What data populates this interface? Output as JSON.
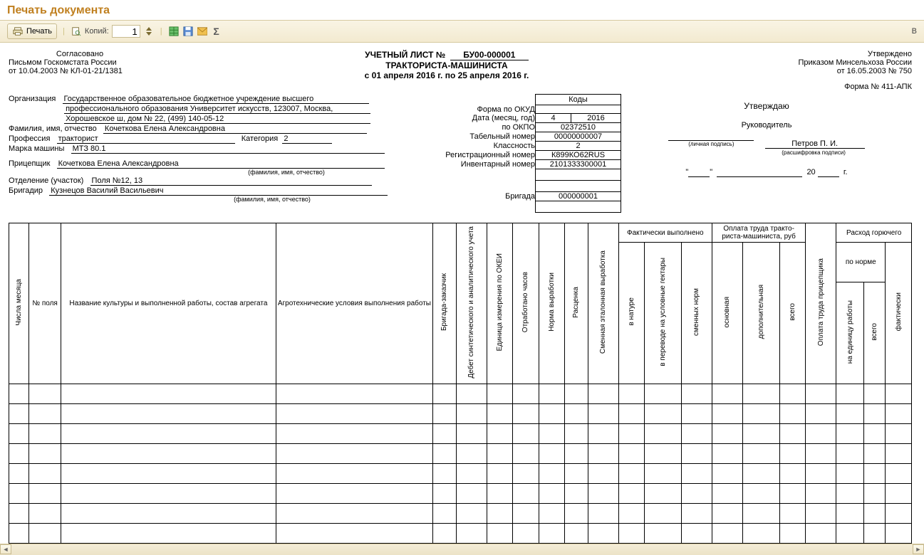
{
  "page_title": "Печать документа",
  "toolbar": {
    "print_label": "Печать",
    "copies_label": "Копий:",
    "copies_value": "1",
    "right_cut": "В"
  },
  "approval_left": {
    "title": "Согласовано",
    "line1": "Письмом Госкомстата России",
    "line2": "от 10.04.2003 № КЛ-01-21/1381"
  },
  "approval_right": {
    "title": "Утверждено",
    "line1": "Приказом Минсельхоза России",
    "line2": "от 16.05.2003 № 750",
    "form": "Форма № 411-АПК",
    "approve": "Утверждаю",
    "leader": "Руководитель",
    "leader_name": "Петров П. И.",
    "sig_hint1": "(личная подпись)",
    "sig_hint2": "(расшифровка подписи)",
    "date_20": "20",
    "date_g": "г."
  },
  "doc_title": {
    "line1_prefix": "УЧЕТНЫЙ ЛИСТ №",
    "number": "БУ00-000001",
    "line2": "ТРАКТОРИСТА-МАШИНИСТА",
    "period": "с 01 апреля 2016 г. по 25 апреля 2016 г."
  },
  "codes": {
    "header": "Коды",
    "okud_lbl": "Форма по ОКУД",
    "okud": "",
    "date_lbl": "Дата (месяц, год)",
    "month": "4",
    "year": "2016",
    "okpo_lbl": "по ОКПО",
    "okpo": "02372510",
    "tabno_lbl": "Табельный номер",
    "tabno": "00000000007",
    "class_lbl": "Классность",
    "class": "2",
    "regno_lbl": "Регистрационный номер",
    "regno": "К899КО62RUS",
    "invno_lbl": "Инвентарный номер",
    "invno": "2101333300001",
    "brigade_lbl": "Бригада",
    "brigade": "000000001"
  },
  "org": {
    "lbl_org": "Организация",
    "org_l1": "Государственное образовательное бюджетное учреждение высшего",
    "org_l2": "профессионального образования  Университет искусств, 123007, Москва,",
    "org_l3": "Хорошевское ш, дом № 22, (499) 140-05-12",
    "lbl_fio": "Фамилия, имя, отчество",
    "fio": "Кочеткова Елена Александровна",
    "lbl_prof": "Профессия",
    "prof": "тракторист",
    "lbl_cat": "Категория",
    "cat": "2",
    "lbl_machine": "Марка машины",
    "machine": "МТЗ 80.1",
    "lbl_pricep": "Прицепщик",
    "pricep": "Кочеткова Елена Александровна",
    "hint_fio": "(фамилия, имя, отчество)",
    "lbl_otdel": "Отделение (участок)",
    "otdel": "Поля №12, 13",
    "lbl_brig": "Бригадир",
    "brig": "Кузнецов Василий Васильевич"
  },
  "grid_headers": {
    "c1": "Числа месяца",
    "c2": "№ поля",
    "c3": "Название культуры и выполненной работы, состав агрегата",
    "c4": "Агротехнические условия выполнения работы",
    "c5": "Бригада-заказчик",
    "c6": "Дебет синтетического и аналитического учета",
    "c7": "Единица измерения по ОКЕИ",
    "c8": "Отработано часов",
    "c9": "Норма выработки",
    "c10": "Расценка",
    "c11": "Сменная эталонная выработка",
    "g_fact": "Фактически выполнено",
    "c12": "в натуре",
    "c13": "в переводе на условные гектары",
    "c14": "сменных норм",
    "g_pay": "Оплата труда тракто-риста-машиниста, руб",
    "c15": "основная",
    "c16": "дополнительная",
    "c17": "всего",
    "c18": "Оплата труда прицепщика",
    "g_fuel": "Расход горючего",
    "g_norm": "по норме",
    "c19": "на единицу работы",
    "c20": "всего",
    "c21": "фактически"
  }
}
